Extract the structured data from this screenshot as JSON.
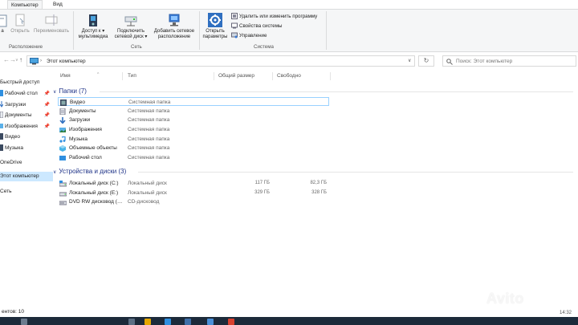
{
  "tabs": [
    {
      "label": "Компьютер",
      "active": true
    },
    {
      "label": "Вид",
      "active": false
    }
  ],
  "ribbon": {
    "location_group": {
      "label": "Расположение",
      "buttons": [
        {
          "label_top": "а",
          "label_bottom": "",
          "icon": "properties-icon"
        },
        {
          "label_top": "Открыть",
          "label_bottom": "",
          "icon": "open-icon"
        },
        {
          "label_top": "Переименовать",
          "label_bottom": "",
          "icon": "rename-icon"
        }
      ]
    },
    "network_group": {
      "label": "Сеть",
      "buttons": [
        {
          "label_top": "Доступ к",
          "label_bottom": "мультимедиа",
          "icon": "media-access-icon",
          "dropdown": "▾"
        },
        {
          "label_top": "Подключить",
          "label_bottom": "сетевой диск",
          "icon": "map-network-drive-icon",
          "dropdown": "▾"
        },
        {
          "label_top": "Добавить сетевое",
          "label_bottom": "расположение",
          "icon": "add-network-location-icon"
        }
      ]
    },
    "system_group": {
      "label": "Система",
      "open_settings": {
        "label_top": "Открыть",
        "label_bottom": "параметры",
        "icon": "gear-icon"
      },
      "commands": [
        {
          "label": "Удалить или изменить программу",
          "icon": "uninstall-icon"
        },
        {
          "label": "Свойства системы",
          "icon": "system-properties-icon"
        },
        {
          "label": "Управление",
          "icon": "manage-icon"
        }
      ]
    }
  },
  "address": {
    "back": "←",
    "forward": "→",
    "recent": "∨",
    "up": "↑",
    "path": "Этот компьютер",
    "refresh": "↻",
    "search_placeholder": "Поиск: Этот компьютер"
  },
  "nav_pane": [
    {
      "label": "Быстрый доступ",
      "icon": "",
      "pinned": false,
      "selected": false
    },
    {
      "label": "Рабочий стол",
      "icon": "desktop-icon",
      "pinned": true,
      "selected": false
    },
    {
      "label": "Загрузки",
      "icon": "downloads-icon",
      "pinned": true,
      "selected": false
    },
    {
      "label": "Документы",
      "icon": "documents-icon",
      "pinned": true,
      "selected": false
    },
    {
      "label": "Изображения",
      "icon": "pictures-icon",
      "pinned": true,
      "selected": false
    },
    {
      "label": "Видео",
      "icon": "videos-icon",
      "pinned": false,
      "selected": false
    },
    {
      "label": "Музыка",
      "icon": "music-icon",
      "pinned": false,
      "selected": false
    },
    {
      "label": "OneDrive",
      "icon": "",
      "pinned": false,
      "selected": false
    },
    {
      "label": "Этот компьютер",
      "icon": "",
      "pinned": false,
      "selected": true
    },
    {
      "label": "Сеть",
      "icon": "",
      "pinned": false,
      "selected": false
    }
  ],
  "columns": {
    "name": "Имя",
    "type": "Тип",
    "total_size": "Общий размер",
    "free": "Свободно"
  },
  "folders_section": {
    "title": "Папки (7)",
    "items": [
      {
        "name": "Видео",
        "type": "Системная папка",
        "icon": "videos-icon",
        "selected": true
      },
      {
        "name": "Документы",
        "type": "Системная папка",
        "icon": "documents-icon",
        "selected": false
      },
      {
        "name": "Загрузки",
        "type": "Системная папка",
        "icon": "downloads-icon",
        "selected": false
      },
      {
        "name": "Изображения",
        "type": "Системная папка",
        "icon": "pictures-icon",
        "selected": false
      },
      {
        "name": "Музыка",
        "type": "Системная папка",
        "icon": "music-icon",
        "selected": false
      },
      {
        "name": "Объемные объекты",
        "type": "Системная папка",
        "icon": "3d-objects-icon",
        "selected": false
      },
      {
        "name": "Рабочий стол",
        "type": "Системная папка",
        "icon": "desktop-icon",
        "selected": false
      }
    ]
  },
  "drives_section": {
    "title": "Устройства и диски (3)",
    "items": [
      {
        "name": "Локальный диск (C:)",
        "type": "Локальный диск",
        "total": "117 ГБ",
        "free": "82,3 ГБ",
        "icon": "hard-drive-icon"
      },
      {
        "name": "Локальный диск (E:)",
        "type": "Локальный диск",
        "total": "329 ГБ",
        "free": "328 ГБ",
        "icon": "hard-drive-icon"
      },
      {
        "name": "DVD RW дисковод (…",
        "type": "CD-дисковод",
        "total": "",
        "free": "",
        "icon": "dvd-drive-icon"
      }
    ]
  },
  "status_bar": {
    "text": "ентов: 10"
  },
  "taskbar": {
    "clock": "14:32"
  },
  "watermark": "Avito",
  "colors": {
    "accent_blue": "#1e3287",
    "selection_fill": "#cce8ff",
    "selection_border": "#99d1ff",
    "ribbon_bg": "#f5f6f7",
    "taskbar_bg": "#1c2a3a"
  }
}
